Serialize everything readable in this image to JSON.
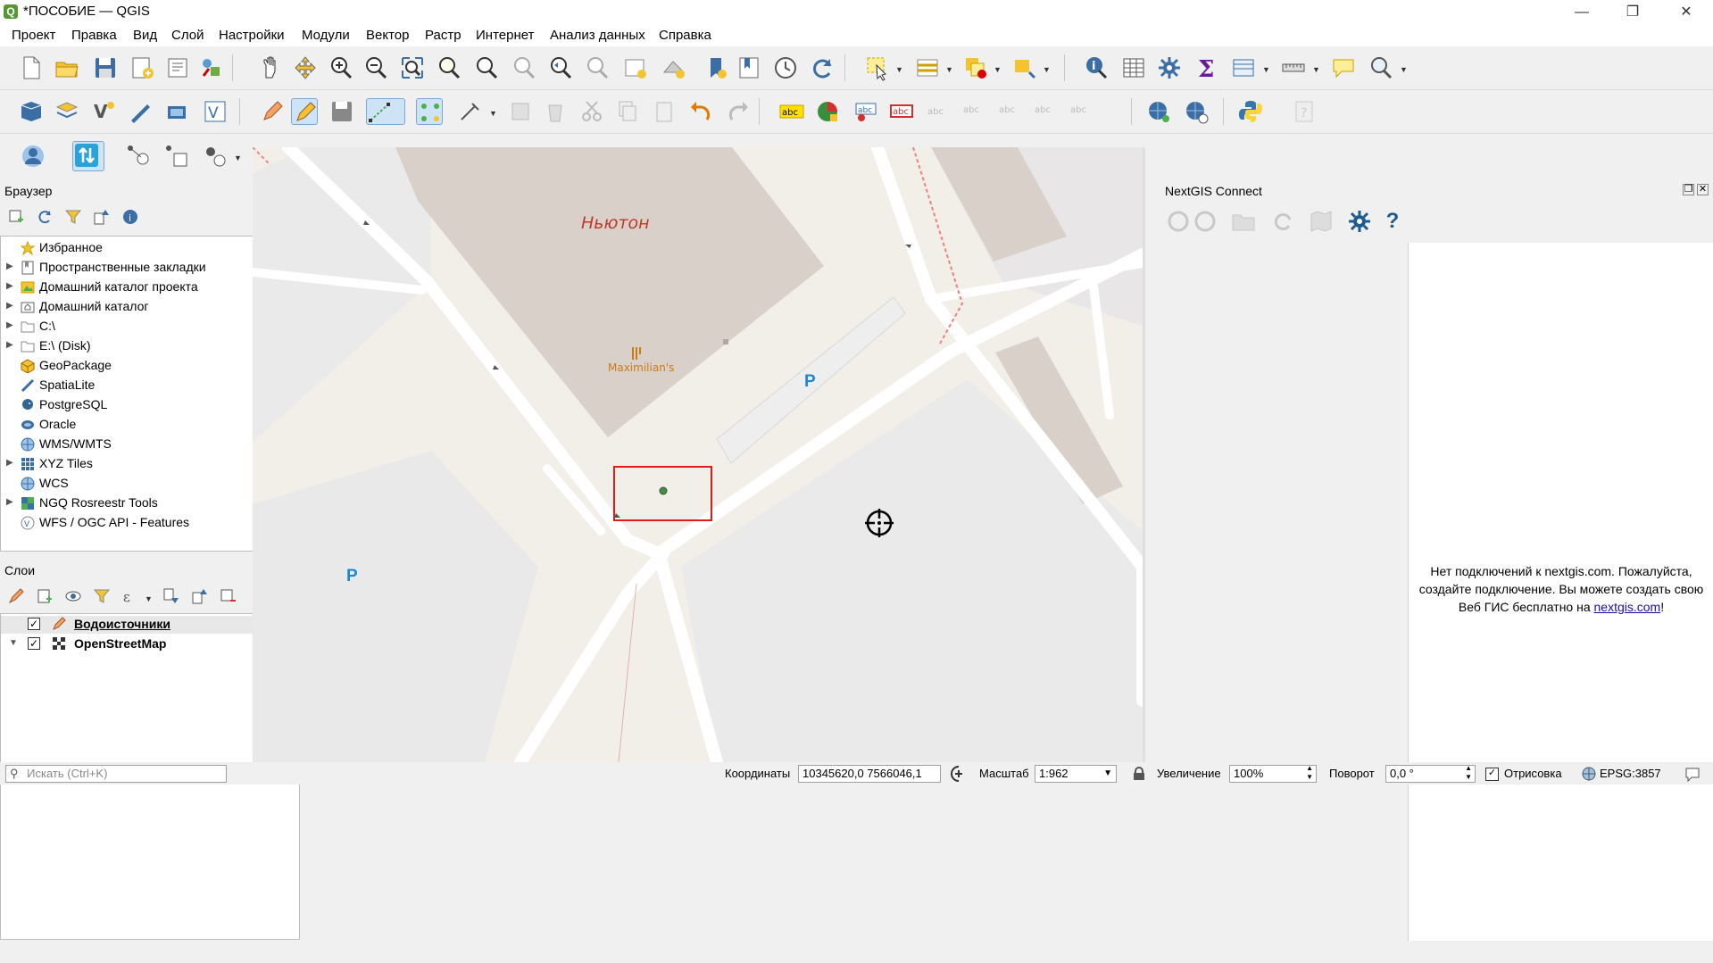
{
  "window": {
    "title": "*ПОСОБИЕ — QGIS",
    "logo_letter": "Q",
    "minimize": "—",
    "maximize": "❐",
    "close": "✕"
  },
  "menu": [
    "Проект",
    "Правка",
    "Вид",
    "Слой",
    "Настройки",
    "Модули",
    "Вектор",
    "Растр",
    "Интернет",
    "Анализ данных",
    "Справка"
  ],
  "browser": {
    "title": "Браузер",
    "items": [
      {
        "label": "Избранное",
        "icon": "star-icon"
      },
      {
        "label": "Пространственные закладки",
        "icon": "bookmark-icon"
      },
      {
        "label": "Домашний каталог проекта",
        "icon": "project-home-icon"
      },
      {
        "label": "Домашний каталог",
        "icon": "home-folder-icon"
      },
      {
        "label": "C:\\",
        "icon": "folder-icon"
      },
      {
        "label": "E:\\ (Disk)",
        "icon": "folder-icon"
      },
      {
        "label": "GeoPackage",
        "icon": "geopackage-icon"
      },
      {
        "label": "SpatiaLite",
        "icon": "spatialite-icon"
      },
      {
        "label": "PostgreSQL",
        "icon": "postgresql-icon"
      },
      {
        "label": "Oracle",
        "icon": "oracle-icon"
      },
      {
        "label": "WMS/WMTS",
        "icon": "wms-icon"
      },
      {
        "label": "XYZ Tiles",
        "icon": "xyz-tiles-icon"
      },
      {
        "label": "WCS",
        "icon": "wcs-icon"
      },
      {
        "label": "NGQ Rosreestr Tools",
        "icon": "rosreestr-icon"
      },
      {
        "label": "WFS / OGC API - Features",
        "icon": "wfs-icon"
      }
    ]
  },
  "layers": {
    "title": "Слои",
    "items": [
      {
        "label": "Водоисточники",
        "checked": true
      },
      {
        "label": "OpenStreetMap",
        "checked": true
      }
    ]
  },
  "map": {
    "labels": {
      "building": "Ньютон",
      "restaurant": "Maximilian's",
      "parking1": "P",
      "parking2": "P"
    }
  },
  "nextgis": {
    "title": "NextGIS Connect",
    "message": "Нет подключений к nextgis.com. Пожалуйста, создайте подключение. Вы можете создать свою Веб ГИС бесплатно на",
    "link": "nextgis.com",
    "suffix": "!"
  },
  "status": {
    "search_placeholder": "Искать (Ctrl+K)",
    "coord_label": "Координаты",
    "coord_value": "10345620,0  7566046,1",
    "scale_label": "Масштаб",
    "scale_value": "1:962",
    "magnifier_label": "Увеличение",
    "magnifier_value": "100%",
    "rotation_label": "Поворот",
    "rotation_value": "0,0 °",
    "render_label": "Отрисовка",
    "crs": "EPSG:3857"
  }
}
